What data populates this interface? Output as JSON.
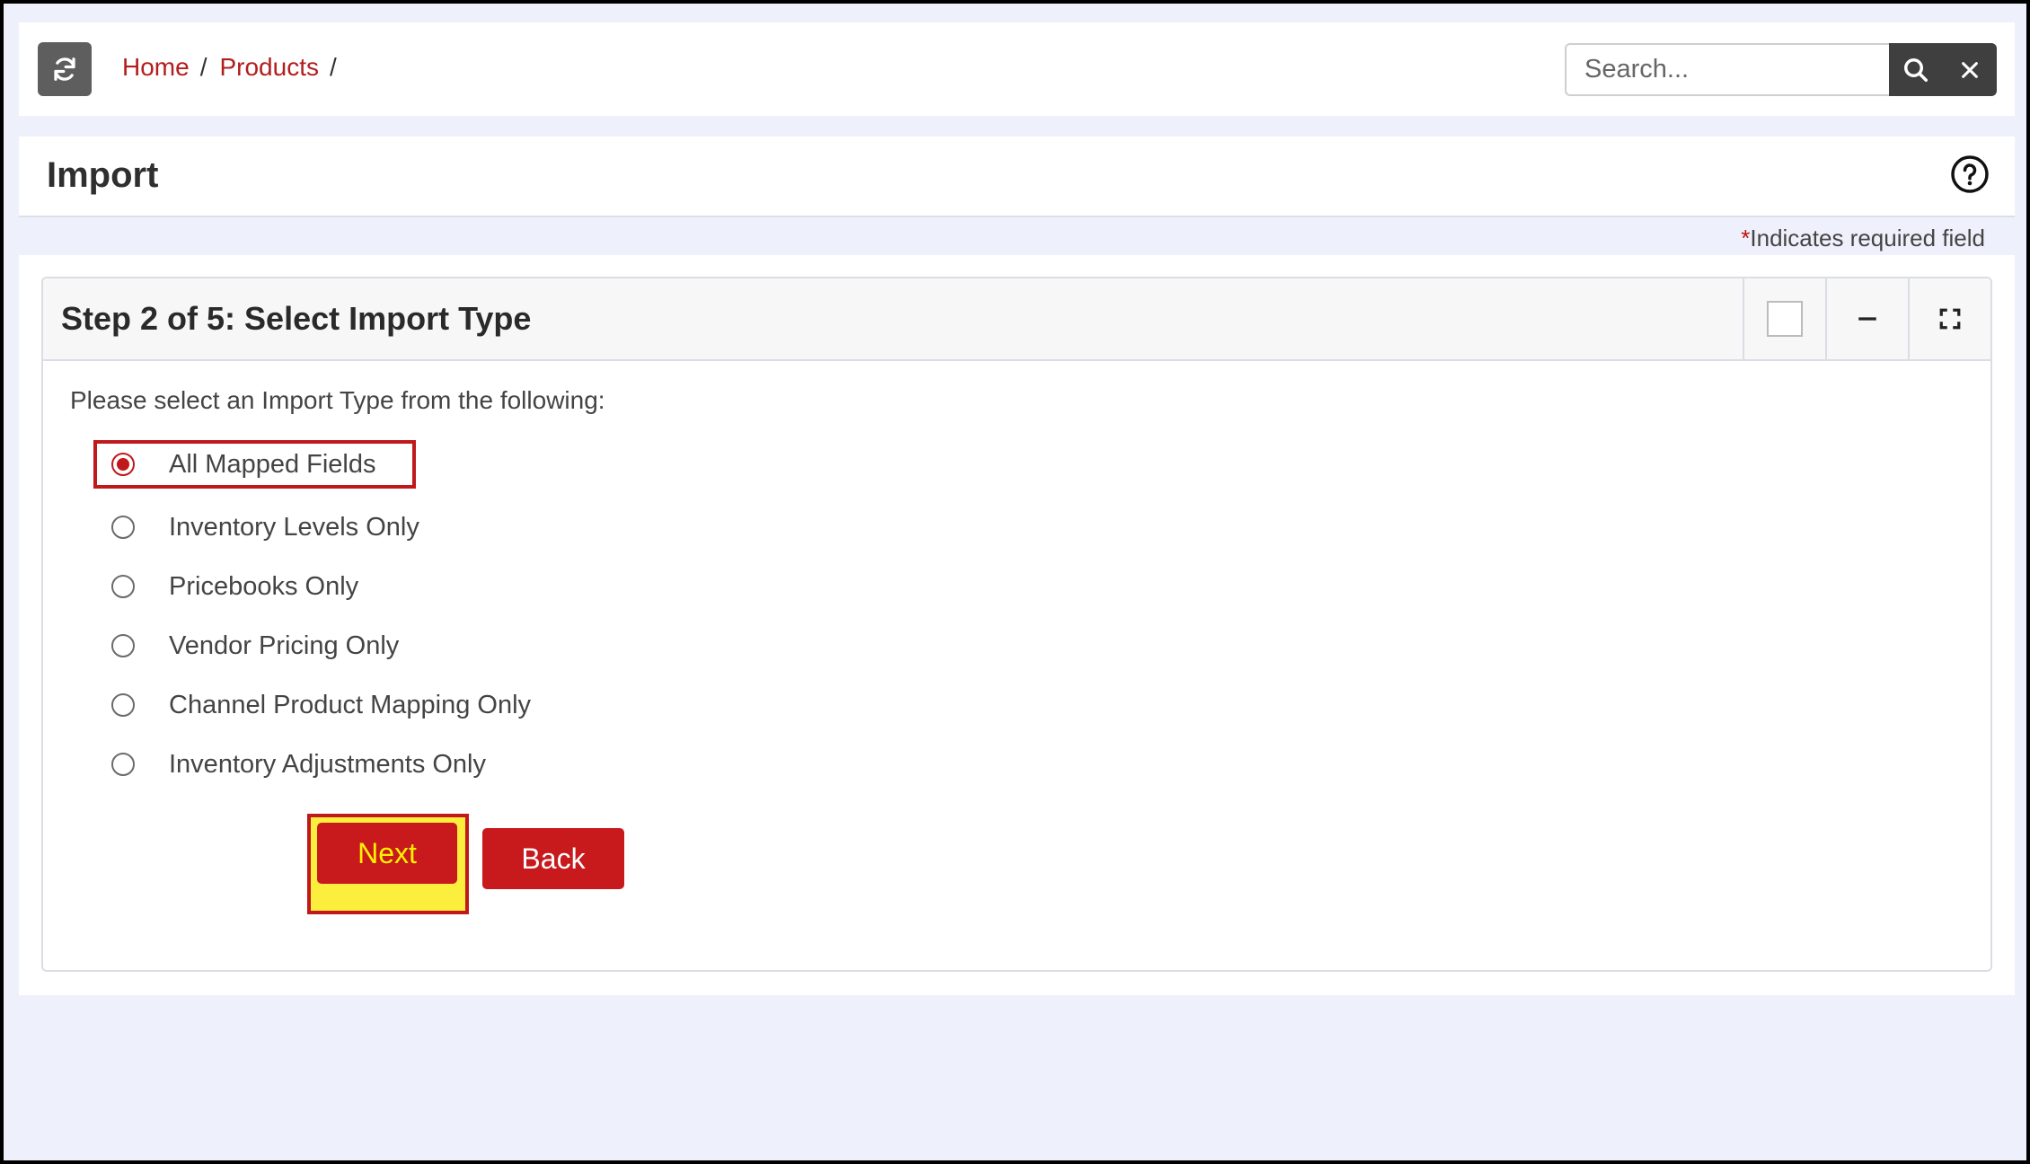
{
  "breadcrumb": {
    "items": [
      "Home",
      "Products"
    ],
    "separator": "/"
  },
  "search": {
    "placeholder": "Search...",
    "value": ""
  },
  "page": {
    "title": "Import",
    "required_star": "*",
    "required_note": "Indicates required field"
  },
  "card": {
    "title": "Step 2 of 5: Select Import Type",
    "prompt": "Please select an Import Type from the following:"
  },
  "import_options": [
    {
      "label": "All Mapped Fields",
      "selected": true
    },
    {
      "label": "Inventory Levels Only",
      "selected": false
    },
    {
      "label": "Pricebooks Only",
      "selected": false
    },
    {
      "label": "Vendor Pricing Only",
      "selected": false
    },
    {
      "label": "Channel Product Mapping Only",
      "selected": false
    },
    {
      "label": "Inventory Adjustments Only",
      "selected": false
    }
  ],
  "buttons": {
    "next": "Next",
    "back": "Back"
  },
  "icons": {
    "refresh": "refresh-icon",
    "search": "search-icon",
    "clear": "close-icon",
    "help": "help-icon",
    "minimize": "minus-icon",
    "expand": "expand-icon"
  },
  "colors": {
    "accent": "#c8191c",
    "highlight": "#fbee3c",
    "background": "#eef1fb"
  }
}
